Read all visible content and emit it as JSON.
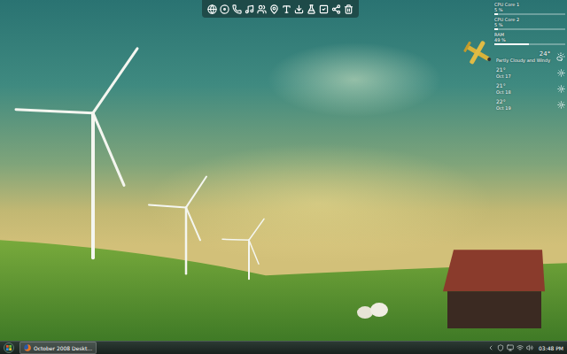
{
  "system_monitor": {
    "meters": [
      {
        "label": "CPU Core 1",
        "reading": "5 %",
        "level": 0.05
      },
      {
        "label": "CPU Core 2",
        "reading": "5 %",
        "level": 0.05
      },
      {
        "label": "RAM",
        "reading": "49 %",
        "level": 0.49
      }
    ]
  },
  "weather": {
    "current": {
      "temperature": "24°",
      "condition": "Partly Cloudy and Windy"
    },
    "forecast": [
      {
        "temperature": "21°",
        "date": "Oct 17"
      },
      {
        "temperature": "21°",
        "date": "Oct 18"
      },
      {
        "temperature": "22°",
        "date": "Oct 19"
      }
    ]
  },
  "taskbar": {
    "tasks": [
      {
        "label": "October 2008 Deskt...",
        "selected": true
      }
    ],
    "clock": "03:48 PM"
  }
}
